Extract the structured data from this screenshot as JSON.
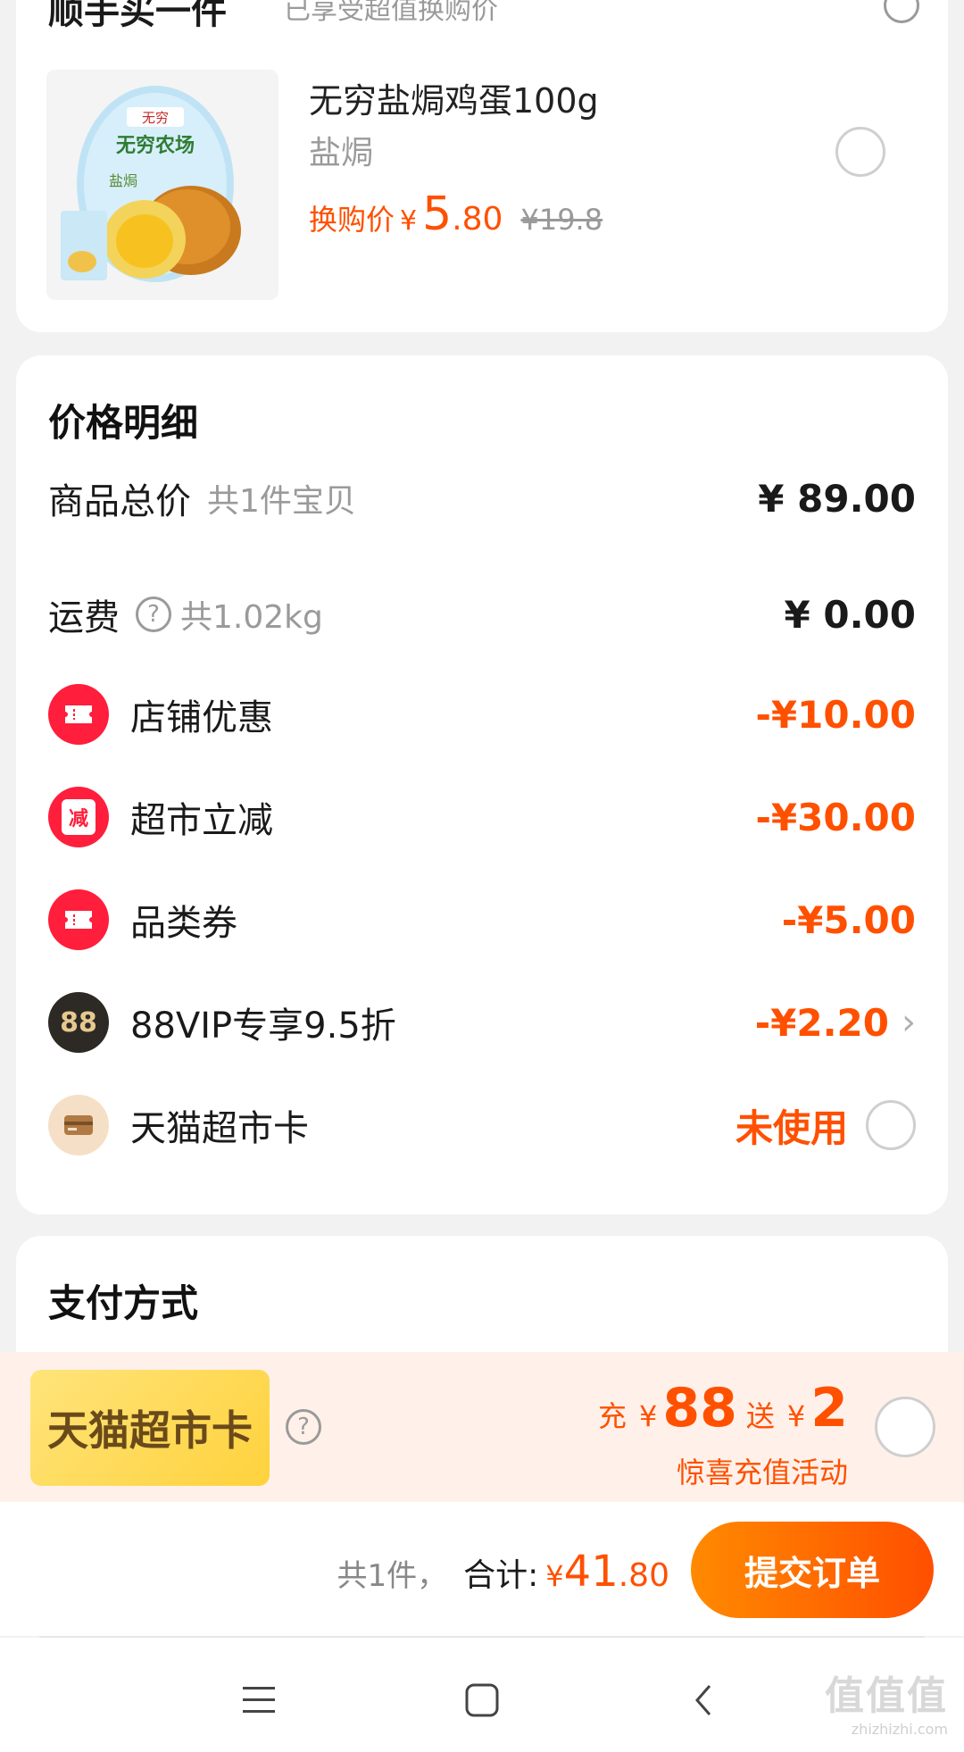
{
  "top_card": {
    "cut_heading": "顺手买一件",
    "cut_subtext": "已享受超值换购价",
    "product": {
      "title": "无穷盐焗鸡蛋100g",
      "spec": "盐焗",
      "price_label": "换购价",
      "yen": "¥",
      "price_int": "5",
      "price_dec": ".80",
      "original_price": "¥19.8",
      "image_brand": "无穷",
      "image_product": "无穷农场",
      "image_flavor": "盐焗"
    }
  },
  "price_detail": {
    "title": "价格明细",
    "goods_total": {
      "label": "商品总价",
      "sub": "共1件宝贝",
      "value": "¥ 89.00"
    },
    "shipping": {
      "label": "运费",
      "help_glyph": "?",
      "sub": "共1.02kg",
      "value": "¥ 0.00"
    },
    "discounts": [
      {
        "label": "店铺优惠",
        "value": "-¥10.00",
        "icon": "ticket-icon"
      },
      {
        "label": "超市立减",
        "value": "-¥30.00",
        "icon": "reduce-icon",
        "icon_text": "减"
      },
      {
        "label": "品类券",
        "value": "-¥5.00",
        "icon": "ticket-icon"
      },
      {
        "label": "88VIP专享9.5折",
        "value": "-¥2.20",
        "icon": "vip-88-icon",
        "icon_text": "88"
      }
    ],
    "tmall_card": {
      "label": "天猫超市卡",
      "status": "未使用",
      "icon": "card-icon"
    }
  },
  "payment": {
    "title": "支付方式",
    "card_name": "天猫超市卡",
    "help_glyph": "?",
    "recharge_prefix": "充",
    "recharge_yen": "¥",
    "recharge_amount": "88",
    "bonus_prefix": "送",
    "bonus_yen": "¥",
    "bonus_amount": "2",
    "activity": "惊喜充值活动"
  },
  "bottom_bar": {
    "count": "共1件，",
    "total_label": "合计:",
    "yen": "¥",
    "total_int": "41",
    "total_dec": ".80",
    "submit": "提交订单"
  },
  "watermark": {
    "main": "值值值",
    "sub": "zhizhizhi.com"
  },
  "colors": {
    "accent": "#ff5000",
    "coupon_red": "#ff1e3c",
    "banner_bg": "#fff1ea"
  }
}
